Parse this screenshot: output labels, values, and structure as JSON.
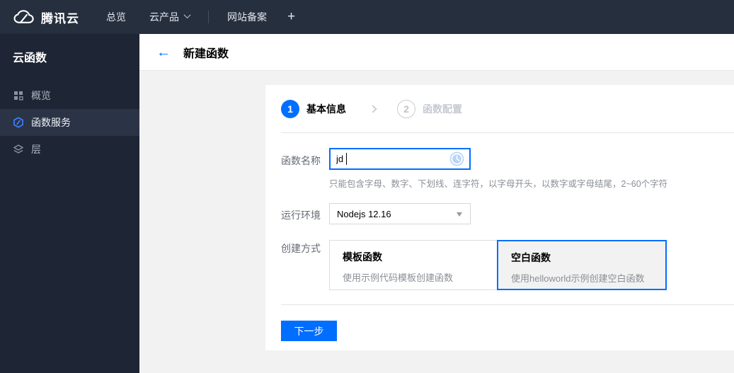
{
  "topbar": {
    "brand": "腾讯云",
    "overview": "总览",
    "products": "云产品",
    "beian": "网站备案",
    "plus": "+"
  },
  "sidebar": {
    "title": "云函数",
    "items": [
      {
        "label": "概览",
        "icon": "grid-overview-icon",
        "active": false
      },
      {
        "label": "函数服务",
        "icon": "hexagon-function-icon",
        "active": true
      },
      {
        "label": "层",
        "icon": "layers-icon",
        "active": false
      }
    ]
  },
  "header": {
    "title": "新建函数"
  },
  "steps": [
    {
      "number": "1",
      "label": "基本信息",
      "state": "current"
    },
    {
      "number": "2",
      "label": "函数配置",
      "state": "pending"
    }
  ],
  "form": {
    "name_label": "函数名称",
    "name_value": "jd",
    "name_help": "只能包含字母、数字、下划线、连字符，以字母开头，以数字或字母结尾，2~60个字符",
    "runtime_label": "运行环境",
    "runtime_value": "Nodejs 12.16",
    "method_label": "创建方式",
    "methods": [
      {
        "title": "模板函数",
        "desc": "使用示例代码模板创建函数",
        "selected": false
      },
      {
        "title": "空白函数",
        "desc": "使用helloworld示例创建空白函数",
        "selected": true
      }
    ],
    "next_button": "下一步"
  },
  "colors": {
    "accent": "#006eff",
    "topbar_bg": "#262f3e",
    "sidebar_bg": "#1e2534",
    "sidebar_active_bg": "#2b3347",
    "content_bg": "#f2f2f2",
    "pending_step": "#cccccc"
  }
}
